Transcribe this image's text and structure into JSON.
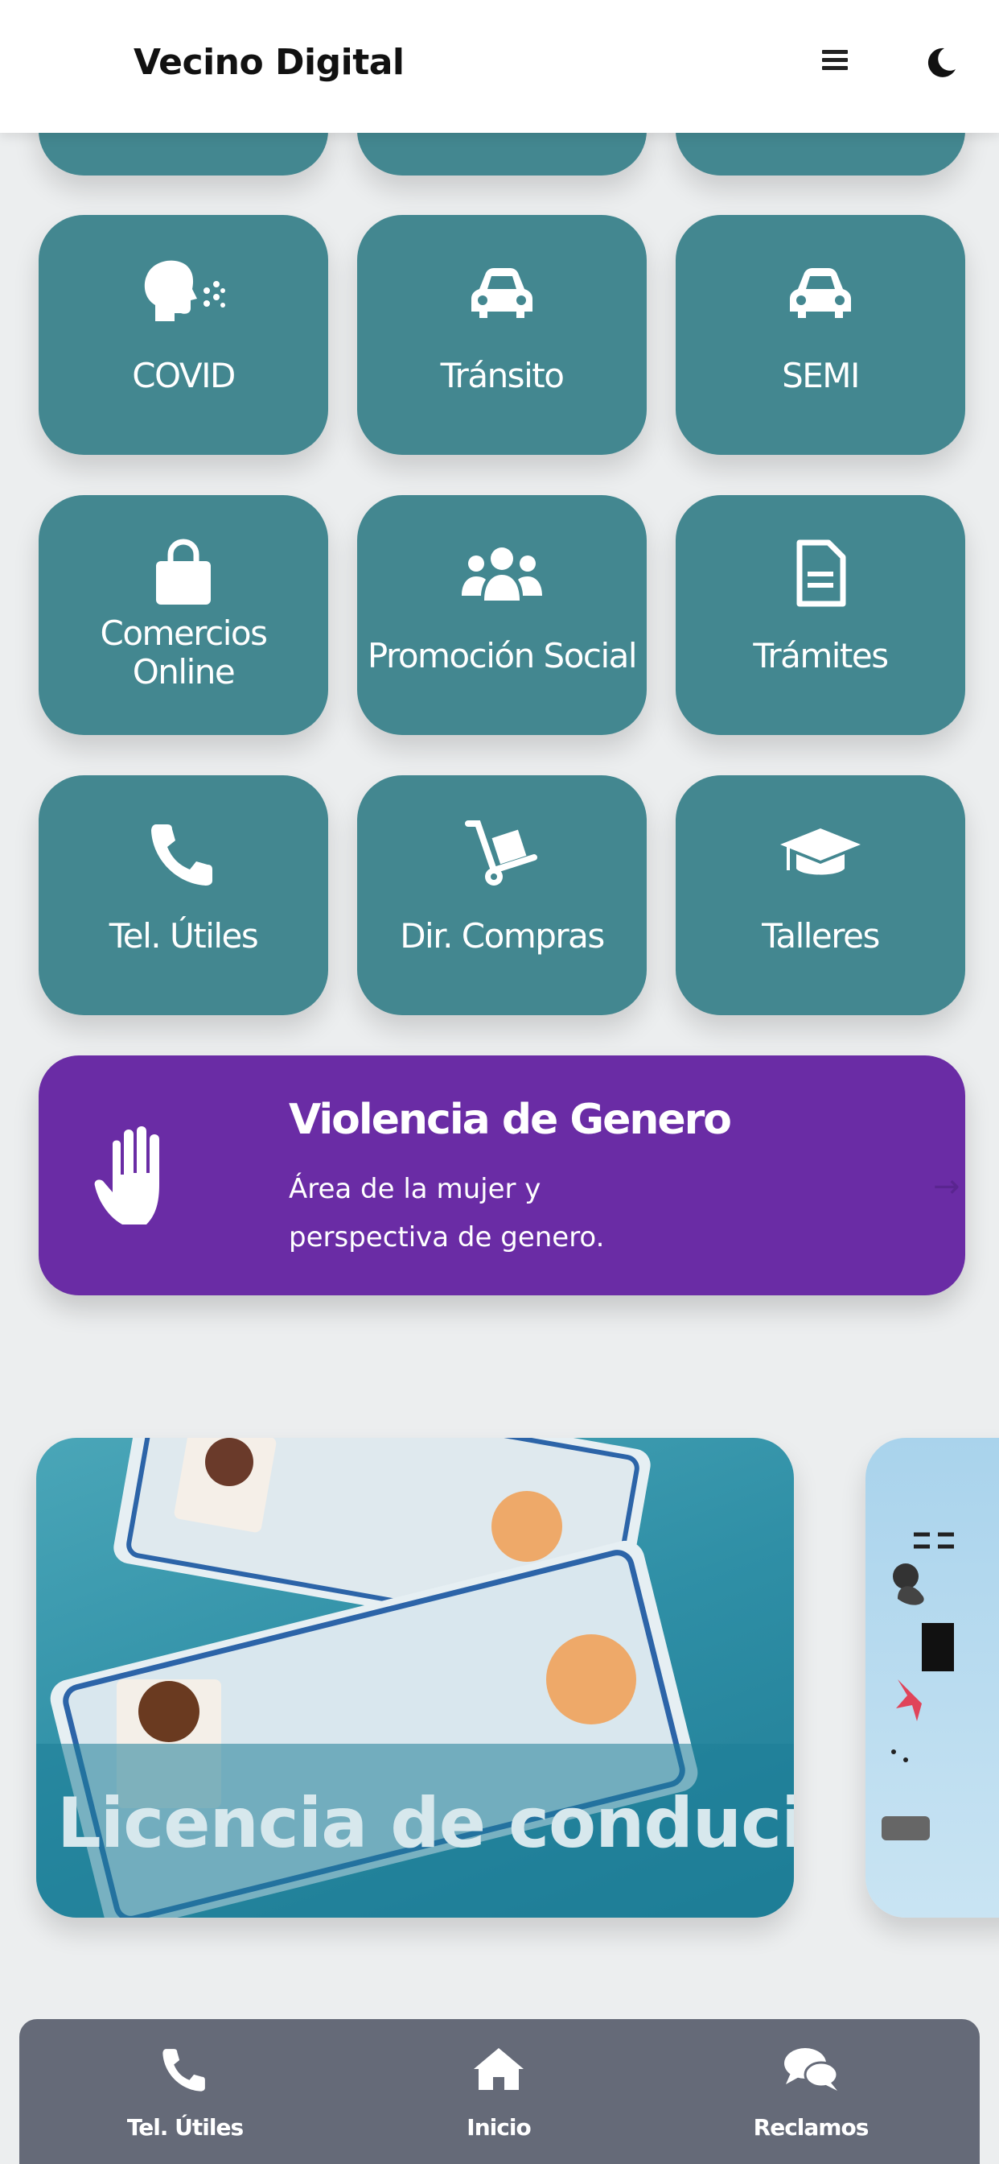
{
  "header": {
    "title": "Vecino Digital",
    "menu_icon": "hamburger-icon",
    "theme_icon": "moon-icon"
  },
  "tiles": [
    {
      "label": "COVID",
      "icon": "cough-icon"
    },
    {
      "label": "Tránsito",
      "icon": "car-icon"
    },
    {
      "label": "SEMI",
      "icon": "car-icon"
    },
    {
      "label": "Comercios Online",
      "icon": "shopping-bag-icon"
    },
    {
      "label": "Promoción Social",
      "icon": "users-icon"
    },
    {
      "label": "Trámites",
      "icon": "document-icon"
    },
    {
      "label": "Tel. Útiles",
      "icon": "phone-icon"
    },
    {
      "label": "Dir. Compras",
      "icon": "dolly-icon"
    },
    {
      "label": "Talleres",
      "icon": "graduation-cap-icon"
    }
  ],
  "banner": {
    "title": "Violencia de Genero",
    "description": "Área de la mujer y perspectiva de genero.",
    "icon": "hand-icon",
    "color": "#6a2ca5"
  },
  "carousel": [
    {
      "title": "Licencia de conducir"
    }
  ],
  "bottom_nav": [
    {
      "label": "Tel. Útiles",
      "icon": "phone-icon"
    },
    {
      "label": "Inicio",
      "icon": "home-icon"
    },
    {
      "label": "Reclamos",
      "icon": "comments-icon"
    }
  ],
  "colors": {
    "tile": "#438790",
    "nav": "#656a78",
    "background": "#eceeef"
  }
}
